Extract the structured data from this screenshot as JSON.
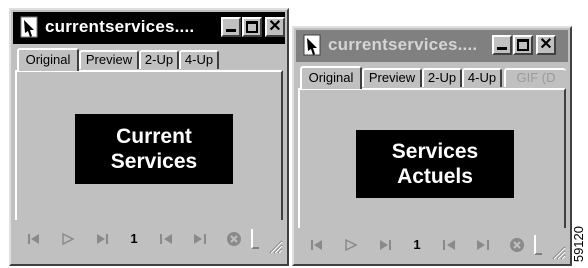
{
  "windows": [
    {
      "title": "currentservices....",
      "tabs": [
        {
          "label": "Original"
        },
        {
          "label": "Preview"
        },
        {
          "label": "2-Up"
        },
        {
          "label": "4-Up"
        }
      ],
      "preview_lines": [
        "Current",
        "Services"
      ],
      "page_number": "1"
    },
    {
      "title": "currentservices....",
      "tabs": [
        {
          "label": "Original"
        },
        {
          "label": "Preview"
        },
        {
          "label": "2-Up"
        },
        {
          "label": "4-Up"
        },
        {
          "label": "GIF (D"
        }
      ],
      "preview_lines": [
        "Services",
        "Actuels"
      ],
      "page_number": "1"
    }
  ],
  "figure_id": "59120",
  "icons": {
    "app": "document-graphic-icon",
    "minimize": "minimize-icon",
    "maximize": "maximize-icon",
    "close": "close-icon",
    "first": "first-frame-icon",
    "play": "play-icon",
    "last": "last-frame-icon",
    "prev": "previous-frame-icon",
    "next": "next-frame-icon",
    "stop": "stop-icon",
    "grip": "resize-grip-icon"
  },
  "colors": {
    "face": "#c0c0c0",
    "active_title": "#000000",
    "inactive_title": "#808080",
    "preview_bg": "#000000",
    "preview_text": "#ffffff"
  }
}
